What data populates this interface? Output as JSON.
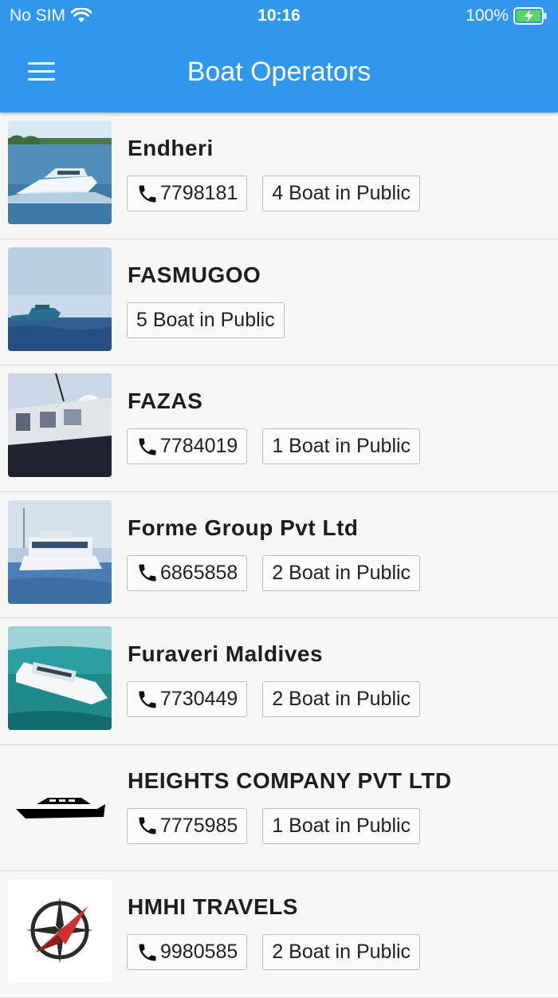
{
  "status_bar": {
    "carrier": "No SIM",
    "time": "10:16",
    "battery": "100%"
  },
  "header": {
    "title": "Boat Operators",
    "menu_icon": "hamburger-menu-icon"
  },
  "colors": {
    "app_bar": "#2f97ee",
    "background": "#f7f7f7"
  },
  "operators": [
    {
      "name": "Endheri",
      "phone": "7798181",
      "boats": "4 Boat in Public",
      "thumb": "speedboat-photo"
    },
    {
      "name": "FASMUGOO",
      "phone": "",
      "boats": "5 Boat in Public",
      "thumb": "boat-at-sea-photo"
    },
    {
      "name": "FAZAS",
      "phone": "7784019",
      "boats": "1 Boat in Public",
      "thumb": "boat-deck-photo"
    },
    {
      "name": "Forme Group Pvt Ltd",
      "phone": "6865858",
      "boats": "2 Boat in Public",
      "thumb": "ferry-photo"
    },
    {
      "name": "Furaveri Maldives",
      "phone": "7730449",
      "boats": "2 Boat in Public",
      "thumb": "white-boat-photo"
    },
    {
      "name": "HEIGHTS COMPANY PVT LTD",
      "phone": "7775985",
      "boats": "1 Boat in Public",
      "thumb": "boat-silhouette-icon"
    },
    {
      "name": "HMHI TRAVELS",
      "phone": "9980585",
      "boats": "2 Boat in Public",
      "thumb": "compass-logo"
    }
  ]
}
